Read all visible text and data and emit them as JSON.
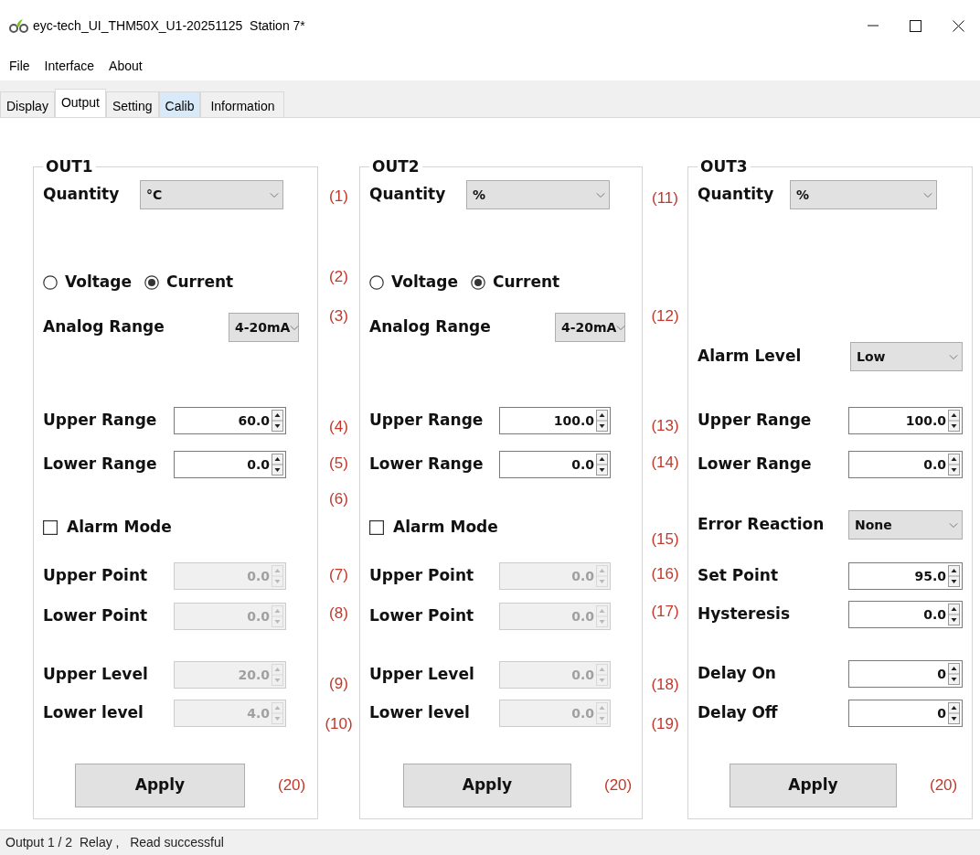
{
  "window": {
    "title": "eyc-tech_UI_THM50X_U1-20251125  Station 7*"
  },
  "menu": [
    "File",
    "Interface",
    "About"
  ],
  "tabs": [
    {
      "label": "Display",
      "selected": false,
      "highlighted": false
    },
    {
      "label": "Output",
      "selected": true,
      "highlighted": false
    },
    {
      "label": "Setting",
      "selected": false,
      "highlighted": false
    },
    {
      "label": "Calib",
      "selected": false,
      "highlighted": true
    },
    {
      "label": "Information",
      "selected": false,
      "highlighted": false
    }
  ],
  "panels": [
    {
      "title": "OUT1",
      "fields": [
        {
          "kind": "combo",
          "label": "Quantity",
          "value": "°C"
        },
        {
          "kind": "radio",
          "options": [
            {
              "label": "Voltage",
              "selected": false
            },
            {
              "label": "Current",
              "selected": true
            }
          ]
        },
        {
          "kind": "combo",
          "label": "Analog Range",
          "value": "4-20mA"
        },
        {
          "kind": "spin",
          "label": "Upper Range",
          "value": "60.0",
          "disabled": false
        },
        {
          "kind": "spin",
          "label": "Lower Range",
          "value": "0.0",
          "disabled": false
        },
        {
          "kind": "checkbox",
          "label": "Alarm Mode",
          "checked": false
        },
        {
          "kind": "spin",
          "label": "Upper Point",
          "value": "0.0",
          "disabled": true
        },
        {
          "kind": "spin",
          "label": "Lower Point",
          "value": "0.0",
          "disabled": true
        },
        {
          "kind": "spin",
          "label": "Upper Level",
          "value": "20.0",
          "disabled": true
        },
        {
          "kind": "spin",
          "label": "Lower level",
          "value": "4.0",
          "disabled": true
        },
        {
          "kind": "button",
          "label": "Apply",
          "annotation": "(20)"
        }
      ],
      "annotations": [
        "(1)",
        "(2)",
        "(3)",
        "(4)",
        "(5)",
        "(6)",
        "(7)",
        "(8)",
        "(9)",
        "(10)"
      ]
    },
    {
      "title": "OUT2",
      "fields": [
        {
          "kind": "combo",
          "label": "Quantity",
          "value": "%"
        },
        {
          "kind": "radio",
          "options": [
            {
              "label": "Voltage",
              "selected": false
            },
            {
              "label": "Current",
              "selected": true
            }
          ]
        },
        {
          "kind": "combo",
          "label": "Analog Range",
          "value": "4-20mA"
        },
        {
          "kind": "spin",
          "label": "Upper Range",
          "value": "100.0",
          "disabled": false
        },
        {
          "kind": "spin",
          "label": "Lower Range",
          "value": "0.0",
          "disabled": false
        },
        {
          "kind": "checkbox",
          "label": "Alarm Mode",
          "checked": false
        },
        {
          "kind": "spin",
          "label": "Upper Point",
          "value": "0.0",
          "disabled": true
        },
        {
          "kind": "spin",
          "label": "Lower Point",
          "value": "0.0",
          "disabled": true
        },
        {
          "kind": "spin",
          "label": "Upper Level",
          "value": "0.0",
          "disabled": true
        },
        {
          "kind": "spin",
          "label": "Lower level",
          "value": "0.0",
          "disabled": true
        },
        {
          "kind": "button",
          "label": "Apply",
          "annotation": "(20)"
        }
      ],
      "annotations": [
        "(11)",
        "(12)",
        "(13)",
        "(14)",
        "(15)",
        "(16)",
        "(17)",
        "(18)",
        "(19)"
      ]
    },
    {
      "title": "OUT3",
      "fields": [
        {
          "kind": "combo",
          "label": "Quantity",
          "value": "%"
        },
        {
          "kind": "combo",
          "label": "Alarm Level",
          "value": "Low"
        },
        {
          "kind": "spin",
          "label": "Upper Range",
          "value": "100.0",
          "disabled": false
        },
        {
          "kind": "spin",
          "label": "Lower Range",
          "value": "0.0",
          "disabled": false
        },
        {
          "kind": "combo",
          "label": "Error Reaction",
          "value": "None"
        },
        {
          "kind": "spin",
          "label": "Set Point",
          "value": "95.0",
          "disabled": false
        },
        {
          "kind": "spin",
          "label": "Hysteresis",
          "value": "0.0",
          "disabled": false
        },
        {
          "kind": "spin",
          "label": "Delay On",
          "value": "0",
          "disabled": false
        },
        {
          "kind": "spin",
          "label": "Delay Off",
          "value": "0",
          "disabled": false
        },
        {
          "kind": "button",
          "label": "Apply",
          "annotation": "(20)"
        }
      ]
    }
  ],
  "status_bar": "Output 1 / 2  Relay ,   Read successful"
}
